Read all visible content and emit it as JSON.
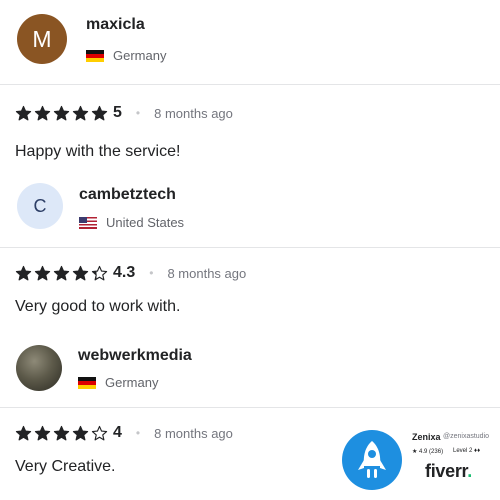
{
  "reviews": [
    {
      "avatar_initial": "M",
      "username": "maxicla",
      "country": "Germany",
      "rating": 5,
      "rating_label": "5",
      "time": "8 months ago",
      "comment": "Happy with the service!"
    },
    {
      "avatar_initial": "C",
      "username": "cambetztech",
      "country": "United States",
      "rating": 4.3,
      "rating_label": "4.3",
      "time": "8 months ago",
      "comment": "Very good to work with."
    },
    {
      "avatar_initial": "",
      "username": "webwerkmedia",
      "country": "Germany",
      "rating": 4,
      "rating_label": "4",
      "time": "8 months ago",
      "comment": "Very Creative."
    }
  ],
  "badge": {
    "name": "Zenixa",
    "handle": "@zenixastudio",
    "rating": "★ 4.9 (236)",
    "level": "Level 2 ♦♦",
    "brand": "fiverr",
    "brand_dot": "."
  },
  "colors": {
    "star": "#222325",
    "avatar_m": "#8a5523",
    "avatar_c": "#dde8f8",
    "badge_logo": "#1e8fe0",
    "fiverr_green": "#1dbf73"
  }
}
